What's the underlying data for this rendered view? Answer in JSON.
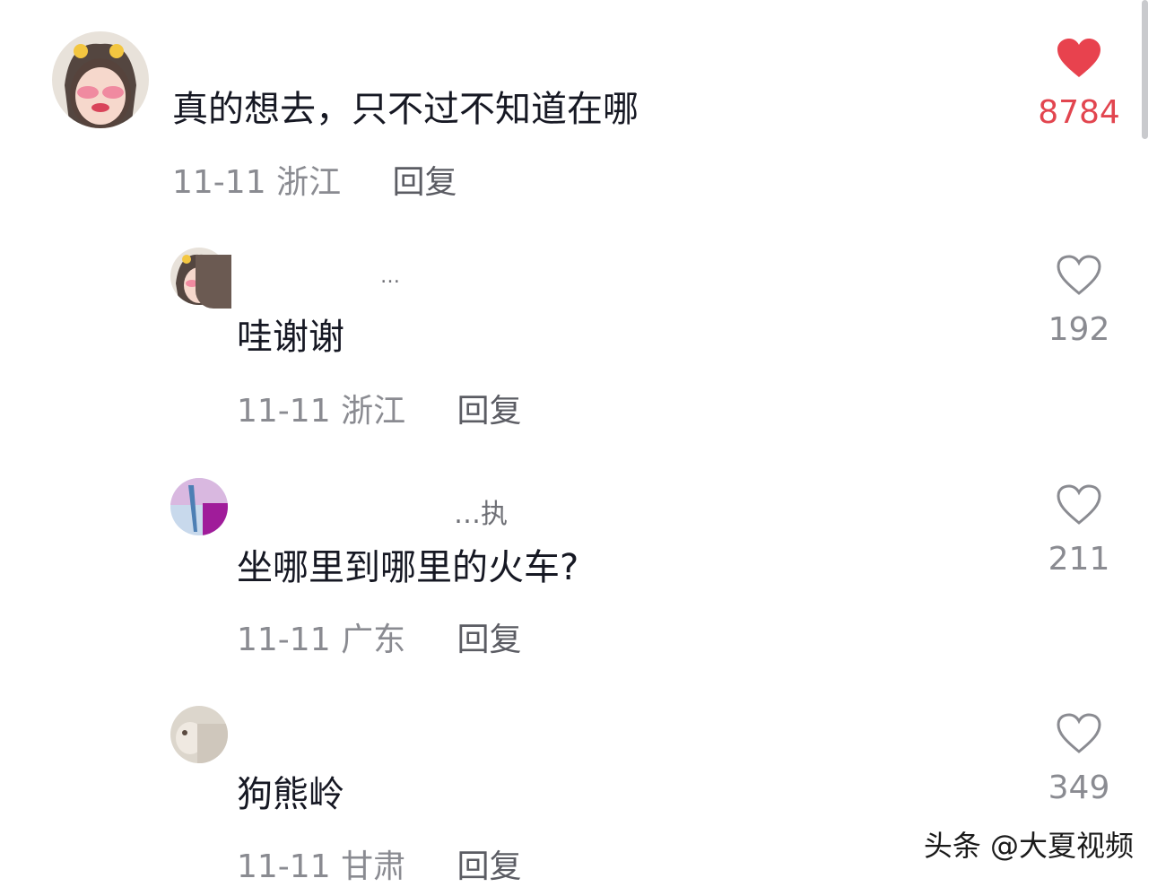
{
  "comments": [
    {
      "username": "",
      "text": "真的想去，只不过不知道在哪",
      "date": "11-11",
      "location": "浙江",
      "reply_label": "回复",
      "likes": "8784",
      "liked": true
    },
    {
      "username": "…",
      "text": "哇谢谢",
      "date": "11-11",
      "location": "浙江",
      "reply_label": "回复",
      "likes": "192",
      "liked": false
    },
    {
      "username": "…执",
      "text": "坐哪里到哪里的火车?",
      "date": "11-11",
      "location": "广东",
      "reply_label": "回复",
      "likes": "211",
      "liked": false
    },
    {
      "username": "",
      "text": "狗熊岭",
      "date": "11-11",
      "location": "甘肃",
      "reply_label": "回复",
      "likes": "349",
      "liked": false
    }
  ],
  "watermark": "头条 @大夏视频",
  "colors": {
    "liked": "#e2454f",
    "meta": "#8a8b91",
    "text": "#161823"
  }
}
